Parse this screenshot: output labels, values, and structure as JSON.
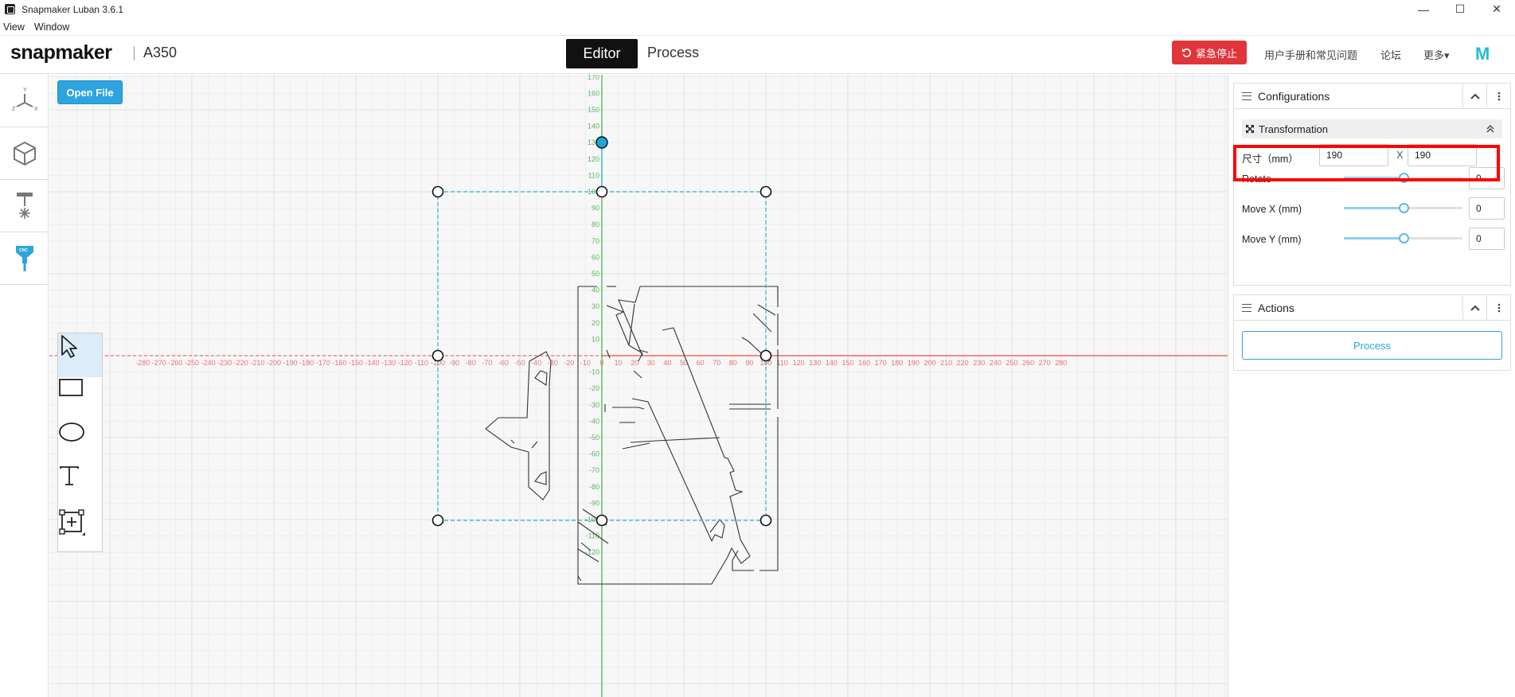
{
  "window": {
    "title": "Snapmaker Luban 3.6.1",
    "minimize": "—",
    "maximize": "☐",
    "close": "✕"
  },
  "menu": {
    "items": [
      "View",
      "Window"
    ]
  },
  "header": {
    "logo": "snapmaker",
    "model": "A350",
    "tabs": {
      "editor": "Editor",
      "process": "Process"
    },
    "estop_label": "紧急停止",
    "links": {
      "manual": "用户手册和常见问题",
      "forum": "论坛",
      "more": "更多▾"
    },
    "brand_mark": "M"
  },
  "canvas": {
    "open_file_label": "Open File",
    "x_ticks": [
      -280,
      -270,
      -260,
      -250,
      -240,
      -230,
      -220,
      -210,
      -200,
      -190,
      -180,
      -170,
      -160,
      -150,
      -140,
      -130,
      -120,
      -110,
      -100,
      -90,
      -80,
      -70,
      -60,
      -50,
      -40,
      -30,
      -20,
      -10,
      0,
      10,
      20,
      30,
      40,
      50,
      60,
      70,
      80,
      90,
      100,
      110,
      120,
      130,
      140,
      150,
      160,
      170,
      180,
      190,
      200,
      210,
      220,
      230,
      240,
      250,
      260,
      270,
      280
    ],
    "y_ticks": [
      170,
      160,
      150,
      140,
      130,
      120,
      110,
      100,
      90,
      80,
      70,
      60,
      50,
      40,
      30,
      20,
      10,
      -10,
      -20,
      -30,
      -40,
      -50,
      -60,
      -70,
      -80,
      -90,
      -100,
      -110,
      -120
    ],
    "colors": {
      "x_axis": "#f04848",
      "y_axis": "#3fae3f",
      "selection": "#28b0d6",
      "rotate_handle": "#1da6d6"
    }
  },
  "draw_tools": [
    "select-pointer-icon",
    "rectangle-icon",
    "ellipse-icon",
    "text-icon",
    "insert-frame-icon"
  ],
  "configurations": {
    "title": "Configurations",
    "transformation_title": "Transformation",
    "size_label": "尺寸（mm）",
    "width": "190",
    "x_sep": "X",
    "height": "190",
    "rotate_label": "Rotate",
    "rotate_value": "0",
    "rotate_level": 0.5,
    "move_x_label": "Move X (mm)",
    "move_x_value": "0",
    "move_x_level": 0.5,
    "move_y_label": "Move Y (mm)",
    "move_y_value": "0",
    "move_y_level": 0.5
  },
  "actions": {
    "title": "Actions",
    "process_label": "Process"
  }
}
